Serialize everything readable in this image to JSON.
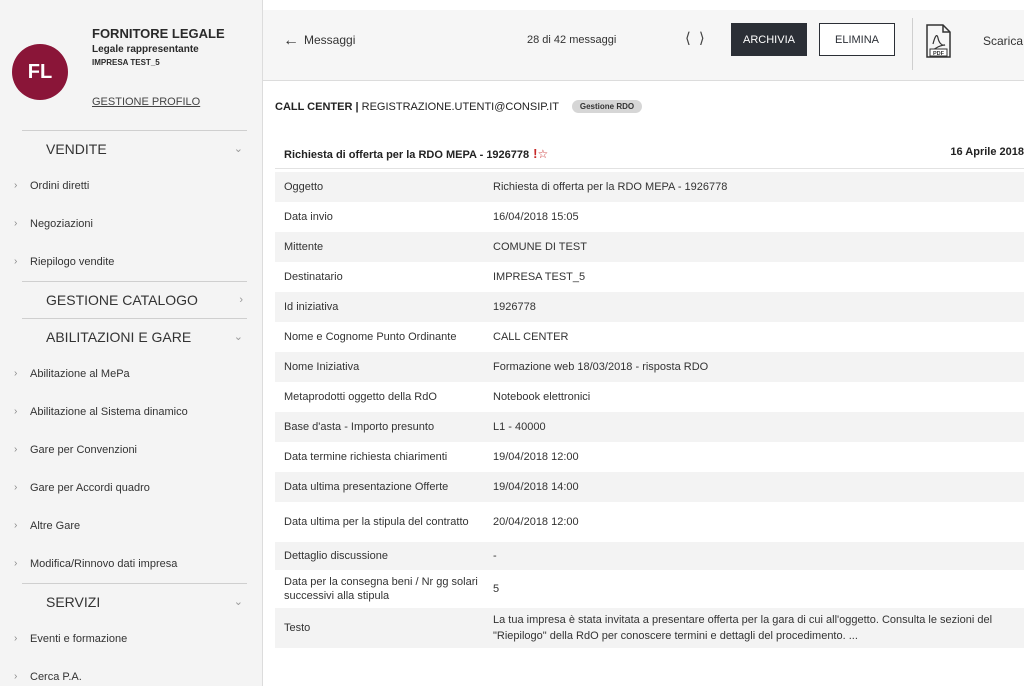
{
  "profile": {
    "initials": "FL",
    "name": "FORNITORE LEGALE",
    "role": "Legale rappresentante",
    "company": "IMPRESA TEST_5",
    "link": "GESTIONE PROFILO"
  },
  "menu": {
    "vendite": {
      "label": "VENDITE",
      "items": [
        "Ordini diretti",
        "Negoziazioni",
        "Riepilogo vendite"
      ]
    },
    "gestione_catalogo": {
      "label": "GESTIONE CATALOGO"
    },
    "abilitazioni": {
      "label": "ABILITAZIONI E GARE",
      "items": [
        "Abilitazione al MePa",
        "Abilitazione al Sistema dinamico",
        "Gare per Convenzioni",
        "Gare per Accordi quadro",
        "Altre Gare",
        "Modifica/Rinnovo dati impresa"
      ]
    },
    "servizi": {
      "label": "SERVIZI",
      "items": [
        "Eventi e formazione",
        "Cerca P.A."
      ]
    }
  },
  "toolbar": {
    "back_label": "Messaggi",
    "count": "28 di 42 messaggi",
    "archivia": "ARCHIVIA",
    "elimina": "ELIMINA",
    "scarica": "Scarica"
  },
  "message": {
    "sender_name": "CALL CENTER",
    "sender_sep": " | ",
    "sender_email": "REGISTRAZIONE.UTENTI@CONSIP.IT",
    "tag": "Gestione RDO",
    "subject": "Richiesta di offerta per la RDO MEPA - 1926778",
    "date": "16 Aprile 2018",
    "details": [
      {
        "label": "Oggetto",
        "value": "Richiesta di offerta per la RDO MEPA - 1926778"
      },
      {
        "label": "Data invio",
        "value": "16/04/2018 15:05"
      },
      {
        "label": "Mittente",
        "value": "COMUNE DI TEST"
      },
      {
        "label": "Destinatario",
        "value": "IMPRESA TEST_5"
      },
      {
        "label": "Id iniziativa",
        "value": "1926778"
      },
      {
        "label": "Nome e Cognome Punto Ordinante",
        "value": "CALL CENTER"
      },
      {
        "label": "Nome Iniziativa",
        "value": "Formazione web 18/03/2018 - risposta RDO"
      },
      {
        "label": "Metaprodotti oggetto della RdO",
        "value": "Notebook elettronici"
      },
      {
        "label": "Base d'asta - Importo presunto",
        "value": "L1 - 40000"
      },
      {
        "label": "Data termine richiesta chiarimenti",
        "value": "19/04/2018 12:00"
      },
      {
        "label": "Data ultima presentazione Offerte",
        "value": "19/04/2018 14:00"
      },
      {
        "label": "Data ultima per la stipula del contratto",
        "value": "20/04/2018 12:00"
      },
      {
        "label": "Dettaglio discussione",
        "value": "-"
      },
      {
        "label": "Data per la consegna beni / Nr gg solari successivi alla stipula",
        "value": "5"
      },
      {
        "label": "Testo",
        "value": "La tua impresa è stata invitata a presentare offerta per la gara di cui all'oggetto. Consulta le sezioni del \"Riepilogo\" della RdO per conoscere termini e dettagli del procedimento. ..."
      }
    ]
  },
  "colors": {
    "avatar": "#8a1538",
    "primary_button": "#2b2f36",
    "accent_red": "#c62828"
  }
}
